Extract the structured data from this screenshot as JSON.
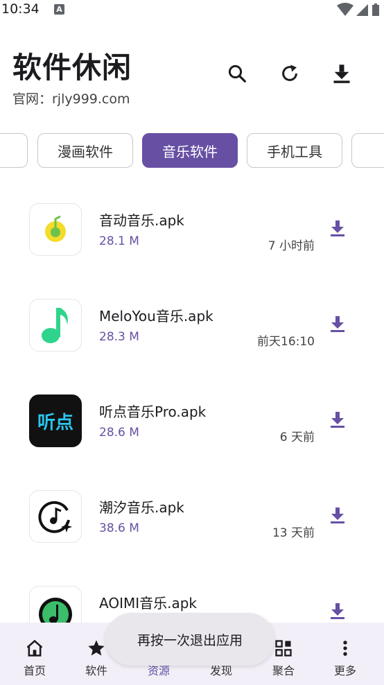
{
  "status_bar": {
    "time": "10:34",
    "notification_badge": "A"
  },
  "header": {
    "title": "软件休闲",
    "subtitle": "官网：rjly999.com",
    "icons": [
      "search-icon",
      "refresh-icon",
      "download-icon"
    ]
  },
  "tabs": [
    {
      "label": "",
      "active": false
    },
    {
      "label": "漫画软件",
      "active": false
    },
    {
      "label": "音乐软件",
      "active": true
    },
    {
      "label": "手机工具",
      "active": false
    },
    {
      "label": "",
      "active": false
    }
  ],
  "apps": [
    {
      "name": "音动音乐.apk",
      "size": "28.1 M",
      "time": "7 小时前",
      "icon": "yindong-logo"
    },
    {
      "name": "MeloYou音乐.apk",
      "size": "28.3 M",
      "time": "前天16:10",
      "icon": "music-note-logo"
    },
    {
      "name": "听点音乐Pro.apk",
      "size": "28.6 M",
      "time": "6 天前",
      "icon": "tingdian-logo",
      "icon_text": "听点"
    },
    {
      "name": "潮汐音乐.apk",
      "size": "38.6 M",
      "time": "13 天前",
      "icon": "chaoxi-logo"
    },
    {
      "name": "AOIMI音乐.apk",
      "size": "",
      "time": "",
      "icon": "aoimi-logo"
    }
  ],
  "bottom_nav": [
    {
      "label": "首页",
      "icon": "home-icon",
      "active": false
    },
    {
      "label": "软件",
      "icon": "star-icon",
      "active": false
    },
    {
      "label": "资源",
      "icon": "folder-icon",
      "active": true
    },
    {
      "label": "发现",
      "icon": "search-icon",
      "active": false
    },
    {
      "label": "聚合",
      "icon": "grid-icon",
      "active": false
    },
    {
      "label": "更多",
      "icon": "more-vert-icon",
      "active": false
    }
  ],
  "toast": {
    "text": "再按一次退出应用"
  },
  "colors": {
    "accent": "#6750a4",
    "nav_bg": "#f3eff8",
    "toast_bg": "#e9e7ec"
  }
}
